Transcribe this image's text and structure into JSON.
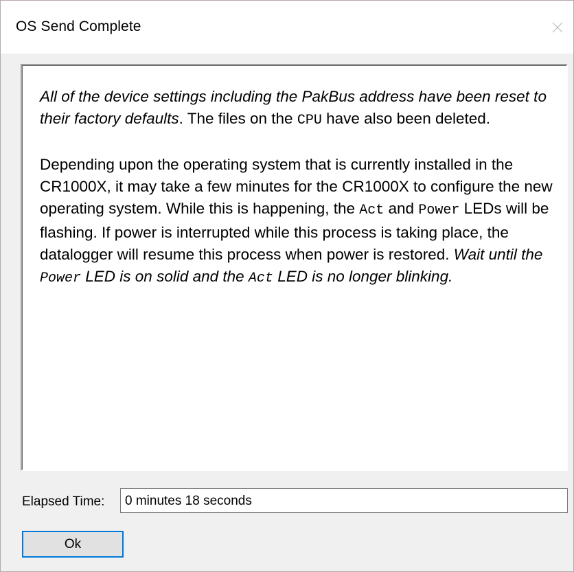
{
  "window": {
    "title": "OS Send Complete",
    "close_icon": "close-icon"
  },
  "message": {
    "p1_italic": "All of the device settings including the PakBus address have been reset to their factory defaults",
    "p1_a": ". The files on the ",
    "p1_code": "CPU",
    "p1_b": " have also been deleted.",
    "p2_a": "Depending upon the operating system that is currently installed in the CR1000X, it may take a few minutes for the CR1000X to configure the new operating system. While this is happening, the ",
    "p2_code_act": "Act",
    "p2_and": " and ",
    "p2_code_power": "Power",
    "p2_b": " LEDs will be flashing. If power is interrupted while this process is taking place, the datalogger will resume this process when power is restored. ",
    "p2_italic_a": "Wait until the ",
    "p2_italic_code_power": "Power",
    "p2_italic_b": " LED is on solid and the ",
    "p2_italic_code_act": "Act",
    "p2_italic_c": " LED is no longer blinking."
  },
  "elapsed": {
    "label": "Elapsed Time:",
    "value": "0 minutes 18 seconds"
  },
  "buttons": {
    "ok_label": "Ok"
  },
  "colors": {
    "dialog_bg": "#f0f0f0",
    "focus_border": "#0078d7"
  }
}
